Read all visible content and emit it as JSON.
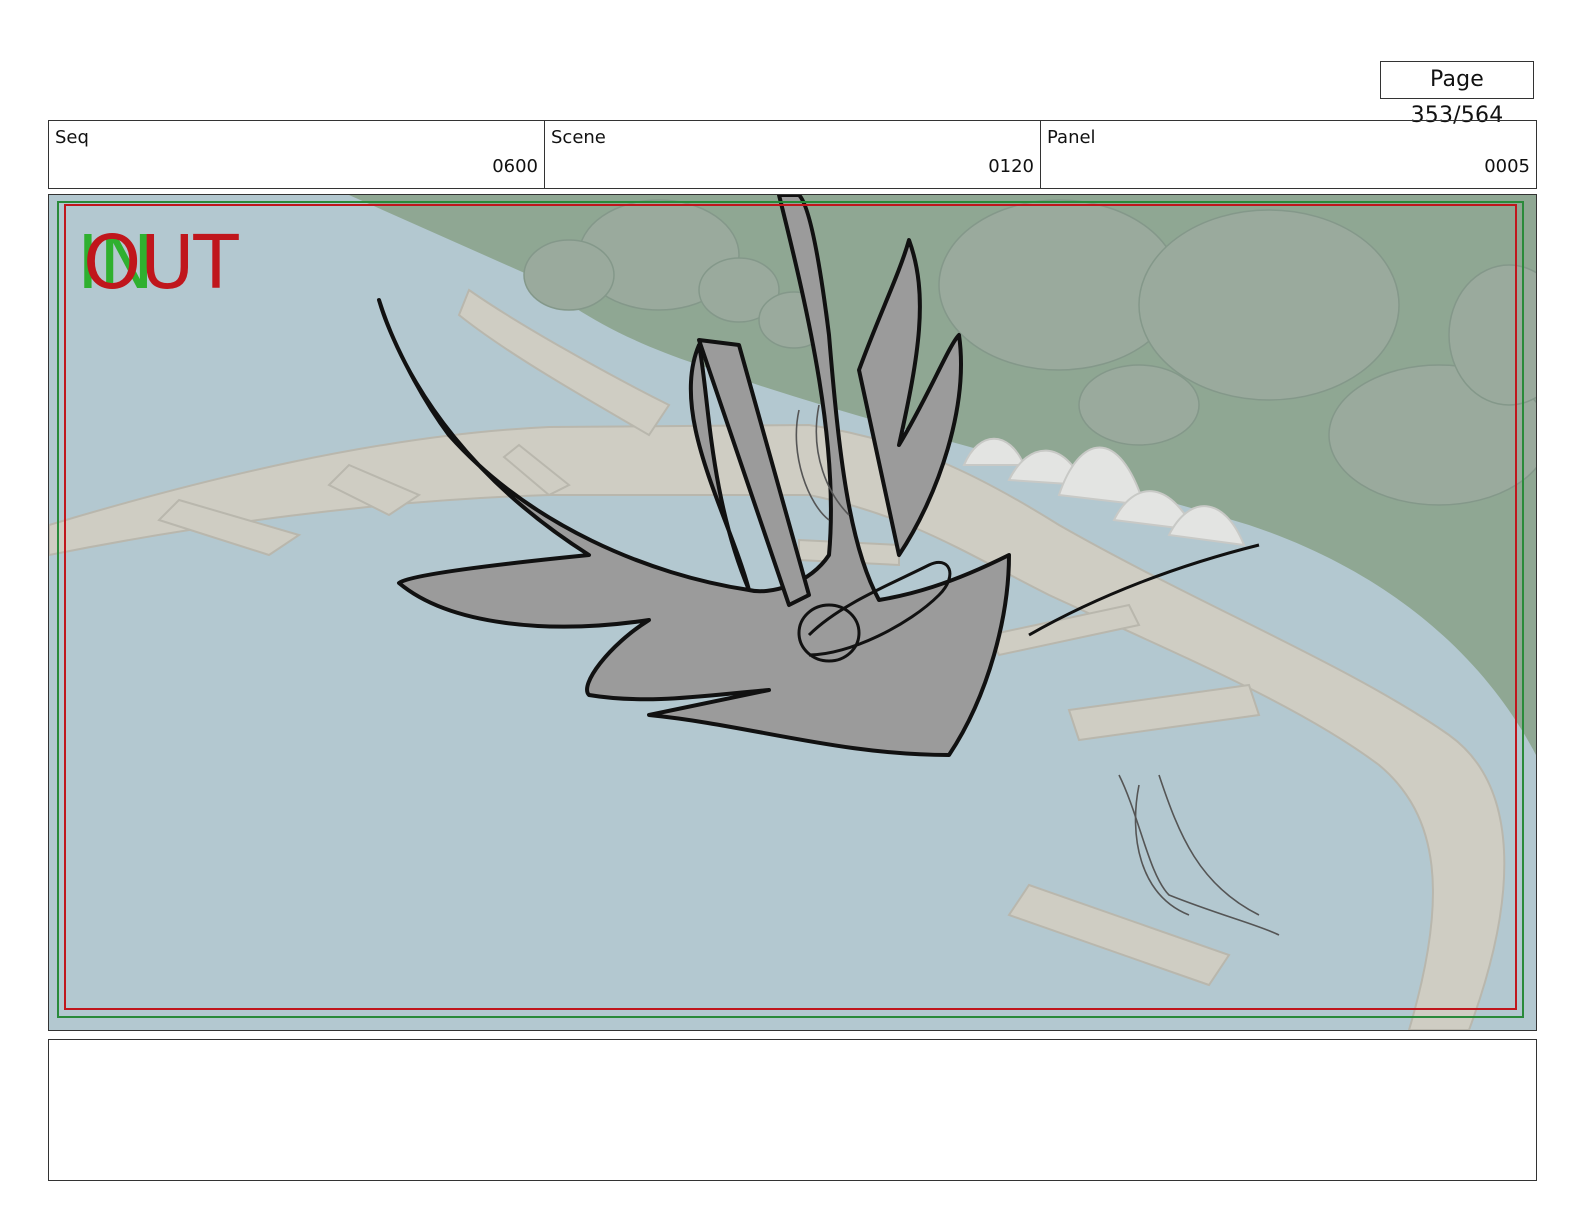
{
  "page": {
    "label": "Page 353/564"
  },
  "header": {
    "seq": {
      "label": "Seq",
      "value": "0600"
    },
    "scene": {
      "label": "Scene",
      "value": "0120"
    },
    "panel": {
      "label": "Panel",
      "value": "0005"
    }
  },
  "frame": {
    "in_marker": "IN",
    "out_marker": "OUT",
    "colors": {
      "water": "#b3c8d0",
      "land": "#8fa793",
      "trees": "#9aaa9d",
      "dock": "#cfcdc3",
      "sketch_fill": "#9b9b9b",
      "safe_green": "#2a8a3a",
      "safe_red": "#c0161c",
      "in_green": "#2fb02f"
    }
  },
  "notes": {
    "text": ""
  }
}
